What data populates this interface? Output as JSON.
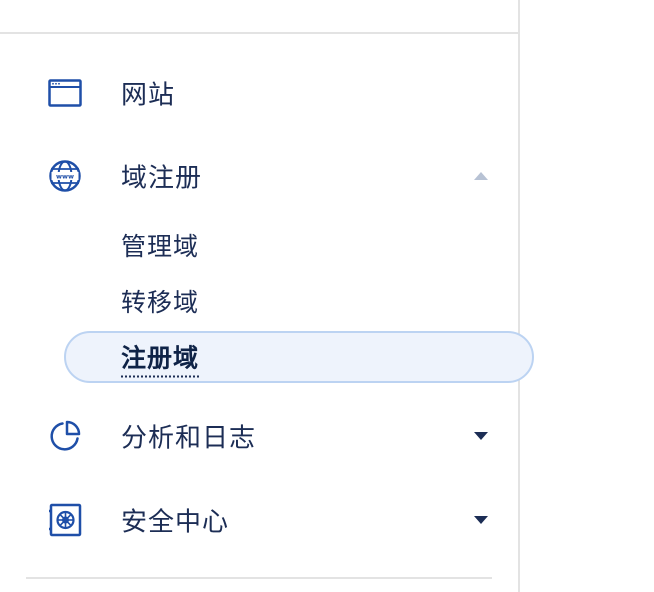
{
  "nav": {
    "items": [
      {
        "label": "网站",
        "icon": "browser-window-icon"
      },
      {
        "label": "域注册",
        "icon": "globe-www-icon",
        "expanded": true,
        "children": [
          {
            "label": "管理域"
          },
          {
            "label": "转移域"
          },
          {
            "label": "注册域",
            "active": true
          }
        ]
      },
      {
        "label": "分析和日志",
        "icon": "pie-chart-icon",
        "expanded": false
      },
      {
        "label": "安全中心",
        "icon": "vault-safe-icon",
        "expanded": false
      }
    ]
  },
  "colors": {
    "text": "#1c2d55",
    "icon": "#1f4fa8",
    "active_bg": "#eef3fc",
    "active_border": "#bcd3f2",
    "divider": "#e3e3e3",
    "caret_collapsed": "#1c2d55",
    "caret_expanded": "#b7c2d4"
  }
}
